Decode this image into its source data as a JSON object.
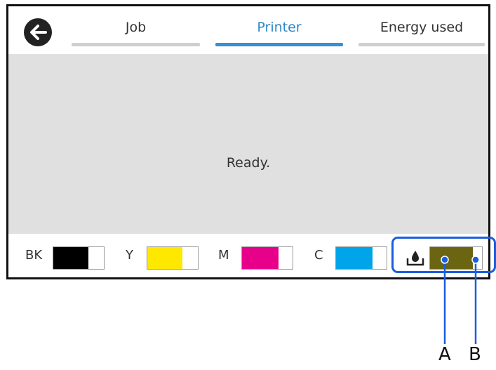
{
  "header": {
    "back_icon": "arrow-left-icon",
    "tabs": [
      {
        "label": "Job",
        "active": false
      },
      {
        "label": "Printer",
        "active": true
      },
      {
        "label": "Energy used",
        "active": false
      }
    ]
  },
  "status": {
    "message": "Ready."
  },
  "ink_levels": [
    {
      "label": "BK",
      "color": "#000000",
      "level": 0.7
    },
    {
      "label": "Y",
      "color": "#ffe800",
      "level": 0.7
    },
    {
      "label": "M",
      "color": "#e6008a",
      "level": 0.72
    },
    {
      "label": "C",
      "color": "#00a4e8",
      "level": 0.72
    }
  ],
  "maintenance_box": {
    "icon": "ink-drop-tray-icon",
    "color": "#6b6512",
    "level": 0.82
  },
  "callouts": {
    "highlight_color": "#1a5ee0",
    "items": [
      {
        "letter": "A"
      },
      {
        "letter": "B"
      }
    ]
  },
  "colors": {
    "active_tab": "#2d86c4",
    "inactive_tab_underline": "#cfcfcf",
    "status_background": "#e0e0e0"
  }
}
